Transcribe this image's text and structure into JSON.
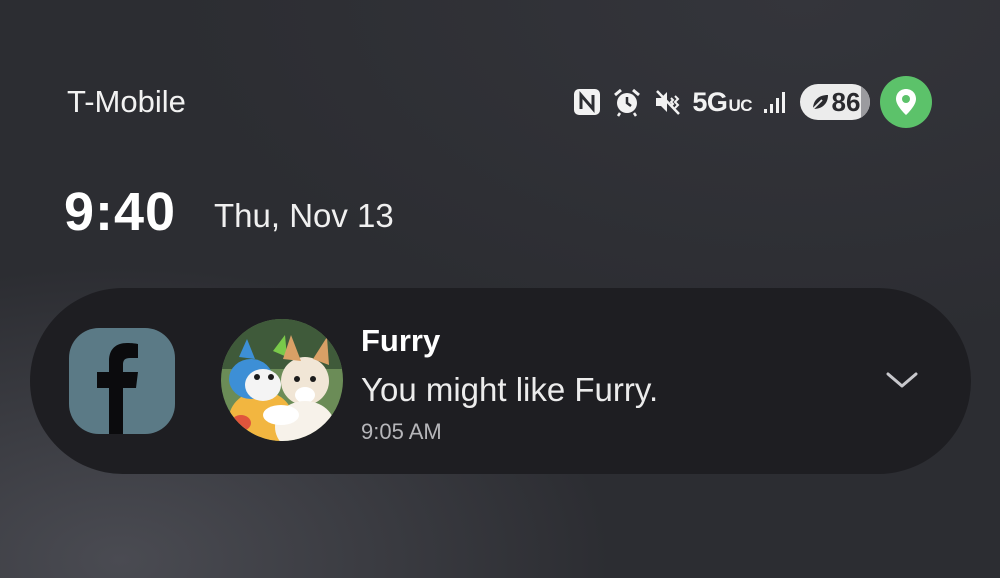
{
  "status_bar": {
    "carrier": "T-Mobile",
    "network": "5G",
    "network_suffix": "UC",
    "battery_level": "86",
    "icons": [
      "nfc-icon",
      "alarm-icon",
      "vibrate-mute-icon",
      "signal-icon",
      "battery-saver-leaf-icon",
      "location-icon"
    ],
    "colors": {
      "location_bg": "#5cc26a",
      "battery_bg": "#ececec"
    }
  },
  "lockscreen": {
    "time": "9:40",
    "date": "Thu, Nov 13"
  },
  "notification": {
    "app_icon": "facebook-icon",
    "title": "Furry",
    "message": "You might like Furry.",
    "time": "9:05 AM",
    "avatar": "furry-mascots-avatar",
    "expand_icon": "chevron-down-icon",
    "colors": {
      "card_bg": "#1e1e22",
      "app_icon_bg": "#5b7a86"
    }
  }
}
